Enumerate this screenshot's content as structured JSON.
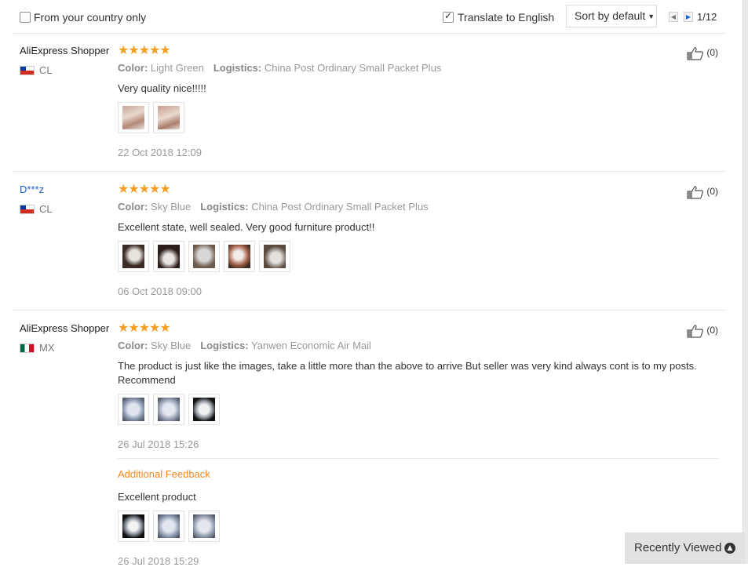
{
  "toolbar": {
    "country_only_label": "From your country only",
    "country_only_checked": false,
    "translate_label": "Translate to English",
    "translate_checked": true,
    "sort_label": "Sort by default",
    "page_label": "1/12"
  },
  "labels": {
    "color": "Color:",
    "logistics": "Logistics:"
  },
  "reviews": [
    {
      "user": "AliExpress Shopper",
      "country": "CL",
      "stars": "★★★★★",
      "color": "Light Green",
      "logistics": "China Post Ordinary Small Packet Plus",
      "text": "Very quality nice!!!!!",
      "helpful": "(0)",
      "date": "22 Oct 2018 12:09"
    },
    {
      "user": "D***z",
      "country": "CL",
      "stars": "★★★★★",
      "color": "Sky Blue",
      "logistics": "China Post Ordinary Small Packet Plus",
      "text": "Excellent state, well sealed. Very good furniture product!!",
      "helpful": "(0)",
      "date": "06 Oct 2018 09:00"
    },
    {
      "user": "AliExpress Shopper",
      "country": "MX",
      "stars": "★★★★★",
      "color": "Sky Blue",
      "logistics": "Yanwen Economic Air Mail",
      "text": "The product is just like the images, take a little more than the above to arrive But seller was very kind always cont is to my posts. Recommend",
      "helpful": "(0)",
      "date": "26 Jul 2018 15:26",
      "additional": {
        "title": "Additional Feedback",
        "text": "Excellent product",
        "date": "26 Jul 2018 15:29"
      }
    }
  ],
  "recently_viewed": "Recently Viewed",
  "colors": {
    "star": "#f59f22",
    "accent_orange": "#f08a26",
    "link_blue": "#1e5fc7"
  }
}
